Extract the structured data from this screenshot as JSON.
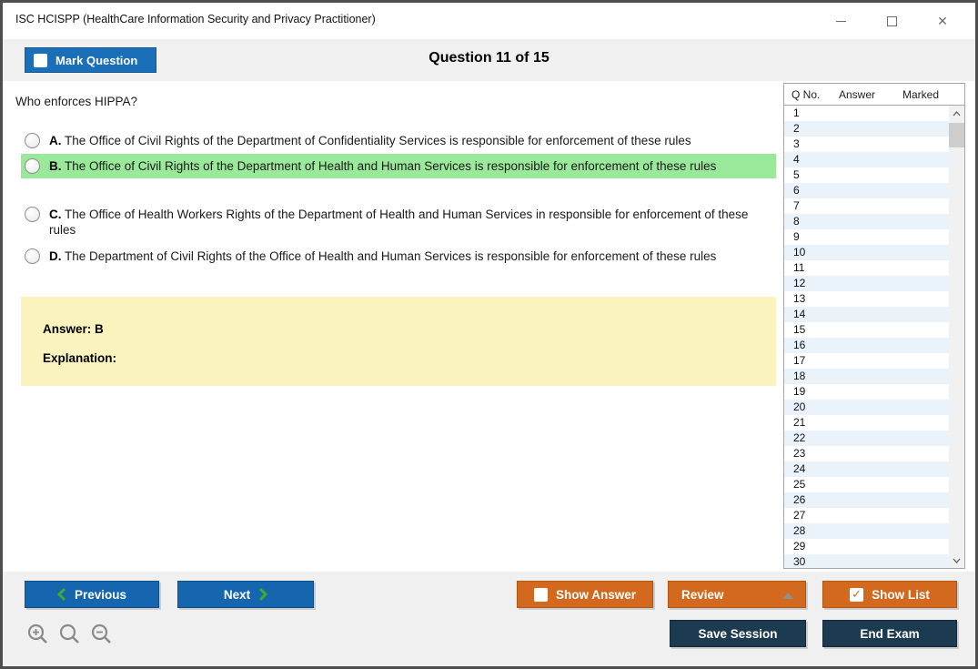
{
  "window": {
    "title": "ISC HCISPP (HealthCare Information Security and Privacy Practitioner)"
  },
  "icons": {
    "close": "✕",
    "check": "✓"
  },
  "header": {
    "mark_question_label": "Mark Question",
    "question_counter": "Question 11 of 15"
  },
  "question": {
    "text": "Who enforces HIPPA?",
    "options": [
      {
        "letter": "A.",
        "text": "The Office of Civil Rights of the Department of Confidentiality Services is responsible for enforcement of these rules",
        "selected": false
      },
      {
        "letter": "B.",
        "text": "The Office of Civil Rights of the Department of Health and Human Services is responsible for enforcement of these rules",
        "selected": true
      },
      {
        "letter": "C.",
        "text": "The Office of Health Workers Rights of the Department of Health and Human Services in responsible for enforcement of these rules",
        "selected": false
      },
      {
        "letter": "D.",
        "text": "The Department of Civil Rights of the Office of Health and Human Services is responsible for enforcement of these rules",
        "selected": false
      }
    ],
    "answer_label": "Answer: B",
    "explanation_label": "Explanation:"
  },
  "question_list": {
    "columns": {
      "qno": "Q No.",
      "answer": "Answer",
      "marked": "Marked"
    },
    "rows": [
      "1",
      "2",
      "3",
      "4",
      "5",
      "6",
      "7",
      "8",
      "9",
      "10",
      "11",
      "12",
      "13",
      "14",
      "15",
      "16",
      "17",
      "18",
      "19",
      "20",
      "21",
      "22",
      "23",
      "24",
      "25",
      "26",
      "27",
      "28",
      "29",
      "30"
    ]
  },
  "footer": {
    "previous_label": "Previous",
    "next_label": "Next",
    "show_answer_label": "Show Answer",
    "review_label": "Review",
    "show_list_label": "Show List",
    "save_session_label": "Save Session",
    "end_exam_label": "End Exam"
  },
  "colors": {
    "accent_blue": "#1566ae",
    "accent_orange": "#d2691e",
    "accent_navy": "#1c3a50",
    "selected_green": "#9ae89a",
    "answer_yellow": "#faf3be",
    "chevron_green": "#3bae2f",
    "alt_row_blue": "#eaf2fa"
  }
}
